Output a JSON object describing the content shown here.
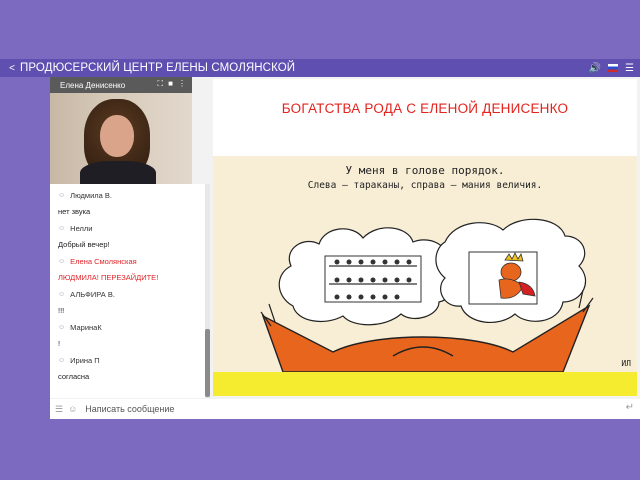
{
  "header": {
    "title": "ПРОДЮСЕРСКИЙ ЦЕНТР ЕЛЕНЫ СМОЛЯНСКОЙ",
    "icons": [
      "share-icon",
      "volume-icon",
      "flag-ru-icon",
      "menu-icon"
    ]
  },
  "video": {
    "presenter": "Елена Денисенко",
    "icons": [
      "expand-icon",
      "camera-icon",
      "more-icon"
    ]
  },
  "chat": {
    "messages": [
      {
        "author": "Людмила В.",
        "text": "нет звука"
      },
      {
        "author": "Нелли",
        "text": "Добрый вечер!"
      },
      {
        "author": "Елена Смолянская",
        "text": "ЛЮДМИЛА! ПЕРЕЗАЙДИТЕ!",
        "highlight": true
      },
      {
        "author": "АЛЬФИРА В.",
        "text": "!!!"
      },
      {
        "author": "МаринаК",
        "text": "!"
      },
      {
        "author": "Ирина П",
        "text": "согласна"
      }
    ],
    "input_placeholder": "Написать сообщение"
  },
  "slide": {
    "title": "БОГАТСТВА РОДА  С ЕЛЕНОЙ ДЕНИСЕНКО",
    "caption_line1": "У меня в голове порядок.",
    "caption_line2": "Слева — тараканы, справа — мания величия.",
    "signature": "ИЛ"
  },
  "colors": {
    "background": "#7b6ac0",
    "topbar": "#5e4fb0",
    "title_red": "#e4231e",
    "fox_orange": "#e8651e"
  }
}
